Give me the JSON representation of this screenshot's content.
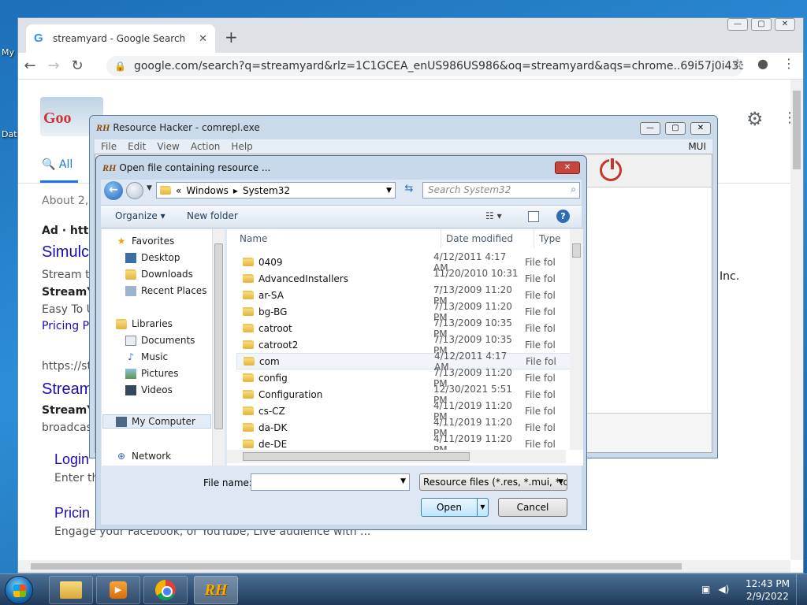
{
  "desktop": {
    "label_1": "My",
    "label_2": "Dat"
  },
  "browser": {
    "tab_title": "streamyard - Google Search",
    "tab_close": "✕",
    "new_tab": "+",
    "url": "google.com/search?q=streamyard&rlz=1C1GCEA_enUS986US986&oq=streamyard&aqs=chrome..69i57j0i433i51...",
    "window_controls": [
      "—",
      "▢",
      "✕"
    ]
  },
  "google": {
    "tab_all": "All",
    "stats": "About 2,5",
    "ad": "Ad · https",
    "results": [
      {
        "title": "Simulc",
        "snippet_1": "Stream to",
        "snippet_2": "StreamYa",
        "snippet_3": "Easy To U",
        "link": "Pricing Pl"
      },
      {
        "url": "https://st",
        "title": "Stream",
        "snippet_1": "StreamYa",
        "snippet_2": "broadcas"
      }
    ],
    "sublinks": [
      {
        "title": "Login",
        "desc": "Enter the"
      },
      {
        "title": "Pricin",
        "desc": "Engage your Facebook, or YouTube, Live audience with ..."
      }
    ],
    "inc_text": "Inc."
  },
  "resource_hacker": {
    "logo": "RH",
    "title": "Resource Hacker - comrepl.exe",
    "menu": [
      "File",
      "Edit",
      "View",
      "Action",
      "Help"
    ],
    "mui": "MUI"
  },
  "dialog": {
    "logo": "RH",
    "title": "Open file containing resource ...",
    "close": "✕",
    "breadcrumb_prefix": "«",
    "breadcrumb": [
      "Windows",
      "System32"
    ],
    "search_placeholder": "Search System32",
    "organize": "Organize ▾",
    "new_folder": "New folder",
    "views": "☷ ▾",
    "help": "?",
    "nav": {
      "favorites": "Favorites",
      "desktop": "Desktop",
      "downloads": "Downloads",
      "recent_places": "Recent Places",
      "libraries": "Libraries",
      "documents": "Documents",
      "music": "Music",
      "pictures": "Pictures",
      "videos": "Videos",
      "my_computer": "My Computer",
      "network": "Network"
    },
    "columns": {
      "name": "Name",
      "date": "Date modified",
      "type": "Type"
    },
    "files": [
      {
        "name": "0409",
        "date": "4/12/2011 4:17 AM",
        "type": "File fol"
      },
      {
        "name": "AdvancedInstallers",
        "date": "11/20/2010 10:31 ...",
        "type": "File fol"
      },
      {
        "name": "ar-SA",
        "date": "7/13/2009 11:20 PM",
        "type": "File fol"
      },
      {
        "name": "bg-BG",
        "date": "7/13/2009 11:20 PM",
        "type": "File fol"
      },
      {
        "name": "catroot",
        "date": "7/13/2009 10:35 PM",
        "type": "File fol"
      },
      {
        "name": "catroot2",
        "date": "7/13/2009 10:35 PM",
        "type": "File fol"
      },
      {
        "name": "com",
        "date": "4/12/2011 4:17 AM",
        "type": "File fol"
      },
      {
        "name": "config",
        "date": "7/13/2009 11:20 PM",
        "type": "File fol"
      },
      {
        "name": "Configuration",
        "date": "12/30/2021 5:51 PM",
        "type": "File fol"
      },
      {
        "name": "cs-CZ",
        "date": "4/11/2019 11:20 PM",
        "type": "File fol"
      },
      {
        "name": "da-DK",
        "date": "4/11/2019 11:20 PM",
        "type": "File fol"
      },
      {
        "name": "de-DE",
        "date": "4/11/2019 11:20 PM",
        "type": "File fol"
      }
    ],
    "file_name_label": "File name:",
    "file_name_value": "",
    "filter": "Resource files (*.res, *.mui, *.dll",
    "open": "Open",
    "cancel": "Cancel"
  },
  "taskbar": {
    "time": "12:43 PM",
    "date": "2/9/2022",
    "rh_label": "RH"
  }
}
